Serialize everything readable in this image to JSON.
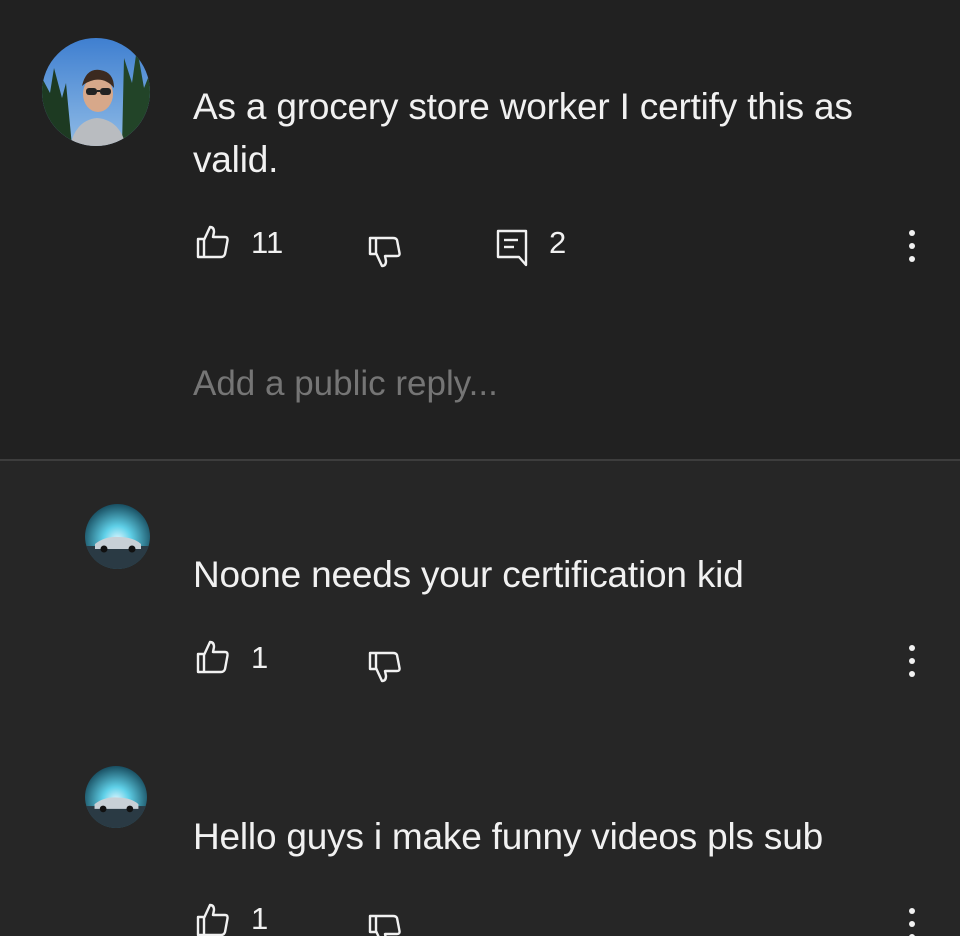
{
  "main_comment": {
    "text": "As a grocery store worker I certify this as valid.",
    "like_count": "11",
    "reply_count": "2",
    "like_icon": "thumb-up-icon",
    "dislike_icon": "thumb-down-icon",
    "reply_icon": "comment-icon",
    "more_icon": "more-vertical-icon"
  },
  "reply_box": {
    "placeholder": "Add a public reply..."
  },
  "replies": [
    {
      "text": "Noone needs your certification kid",
      "like_count": "1"
    },
    {
      "text": "Hello guys i make funny videos pls sub",
      "like_count": "1"
    }
  ],
  "colors": {
    "main_background": "#212121",
    "reply_background": "#262626",
    "divider": "#3d3d3d",
    "text": "#f1f1f1",
    "placeholder": "#8c8c8c"
  }
}
